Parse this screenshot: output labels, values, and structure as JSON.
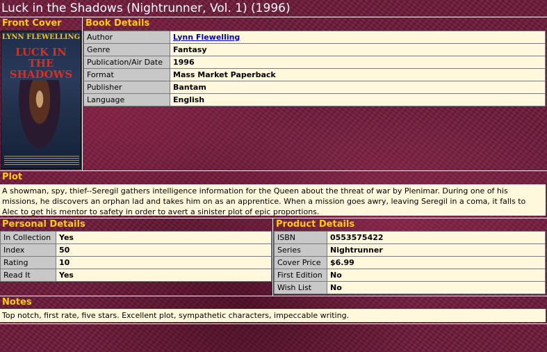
{
  "page": {
    "title": "Luck in the Shadows (Nightrunner, Vol. 1) (1996)"
  },
  "front_cover": {
    "header": "Front Cover",
    "cover_author": "LYNN FLEWELLING",
    "cover_title": "LUCK IN THE SHADOWS"
  },
  "book_details": {
    "header": "Book Details",
    "rows": [
      {
        "label": "Author",
        "value": "Lynn Flewelling"
      },
      {
        "label": "Genre",
        "value": "Fantasy"
      },
      {
        "label": "Publication/Air Date",
        "value": "1996"
      },
      {
        "label": "Format",
        "value": "Mass Market Paperback"
      },
      {
        "label": "Publisher",
        "value": "Bantam"
      },
      {
        "label": "Language",
        "value": "English"
      }
    ]
  },
  "plot": {
    "header": "Plot",
    "text": "A showman, spy, thief--Seregil gathers intelligence information for the Queen about the threat of war by Plenimar. During one of his missions, he discovers an orphan lad and takes him on as an apprentice. When a mission goes awry, leaving Seregil in a coma, it falls to Alec to get his mentor to safety in order to avert a sinister plot of epic proportions."
  },
  "personal_details": {
    "header": "Personal Details",
    "rows": [
      {
        "label": "In Collection",
        "value": "Yes"
      },
      {
        "label": "Index",
        "value": "50"
      },
      {
        "label": "Rating",
        "value": "10"
      },
      {
        "label": "Read It",
        "value": "Yes"
      }
    ]
  },
  "product_details": {
    "header": "Product Details",
    "rows": [
      {
        "label": "ISBN",
        "value": "0553575422"
      },
      {
        "label": "Series",
        "value": "Nightrunner"
      },
      {
        "label": "Cover Price",
        "value": "$6.99"
      },
      {
        "label": "First Edition",
        "value": "No"
      },
      {
        "label": "Wish List",
        "value": "No"
      }
    ]
  },
  "notes": {
    "header": "Notes",
    "text": "Top notch, first rate, five stars. Excellent plot, sympathetic characters, impeccable writing."
  },
  "colors": {
    "background": "#6e1a3a",
    "header_text": "#ffcc00",
    "label_cell": "#c8c8c8",
    "value_cell": "#fff8dc",
    "link": "#0000cc"
  }
}
